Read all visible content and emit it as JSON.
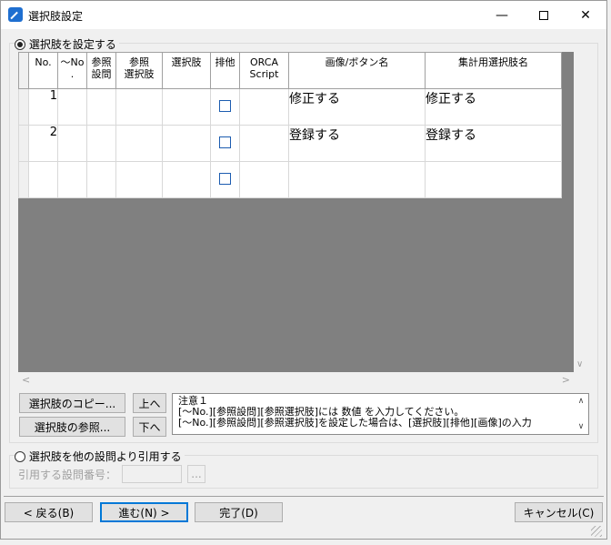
{
  "window": {
    "title": "選択肢設定",
    "minimize_glyph": "—",
    "close_glyph": "✕"
  },
  "option1": {
    "label": "選択肢を設定する",
    "selected": true
  },
  "grid": {
    "headers": [
      "No.",
      "～No\n.",
      "参照\n設問",
      "参照\n選択肢",
      "選択肢",
      "排他",
      "ORCA\nScript",
      "画像/ボタン名",
      "集計用選択肢名"
    ],
    "rows": [
      {
        "no": "1",
        "tilde_no": "",
        "ref_q": "",
        "ref_opt": "",
        "option": "",
        "exclusive": false,
        "orca": "",
        "image_button": "修正する",
        "agg_name": "修正する"
      },
      {
        "no": "2",
        "tilde_no": "",
        "ref_q": "",
        "ref_opt": "",
        "option": "",
        "exclusive": false,
        "orca": "",
        "image_button": "登録する",
        "agg_name": "登録する"
      },
      {
        "no": "",
        "tilde_no": "",
        "ref_q": "",
        "ref_opt": "",
        "option": "",
        "exclusive": false,
        "orca": "",
        "image_button": "",
        "agg_name": ""
      }
    ],
    "hscroll_left": "<",
    "hscroll_right": ">",
    "vscroll_down": "∨"
  },
  "buttons": {
    "copy_options": "選択肢のコピー...",
    "up": "上へ",
    "reference_options": "選択肢の参照...",
    "down": "下へ",
    "back": "< 戻る(B)",
    "next": "進む(N) >",
    "finish": "完了(D)",
    "cancel": "キャンセル(C)",
    "browse": "..."
  },
  "notes": {
    "line1": "注意１",
    "line2": "[～No.][参照設問][参照選択肢]には 数値 を入力してください。",
    "line3": "[～No.][参照設問][参照選択肢]を設定した場合は、[選択肢][排他][画像]の入力",
    "scroll_up": "∧",
    "scroll_down": "∨"
  },
  "option2": {
    "label": "選択肢を他の設問より引用する",
    "selected": false,
    "ref_label": "引用する設問番号：",
    "ref_value": ""
  }
}
